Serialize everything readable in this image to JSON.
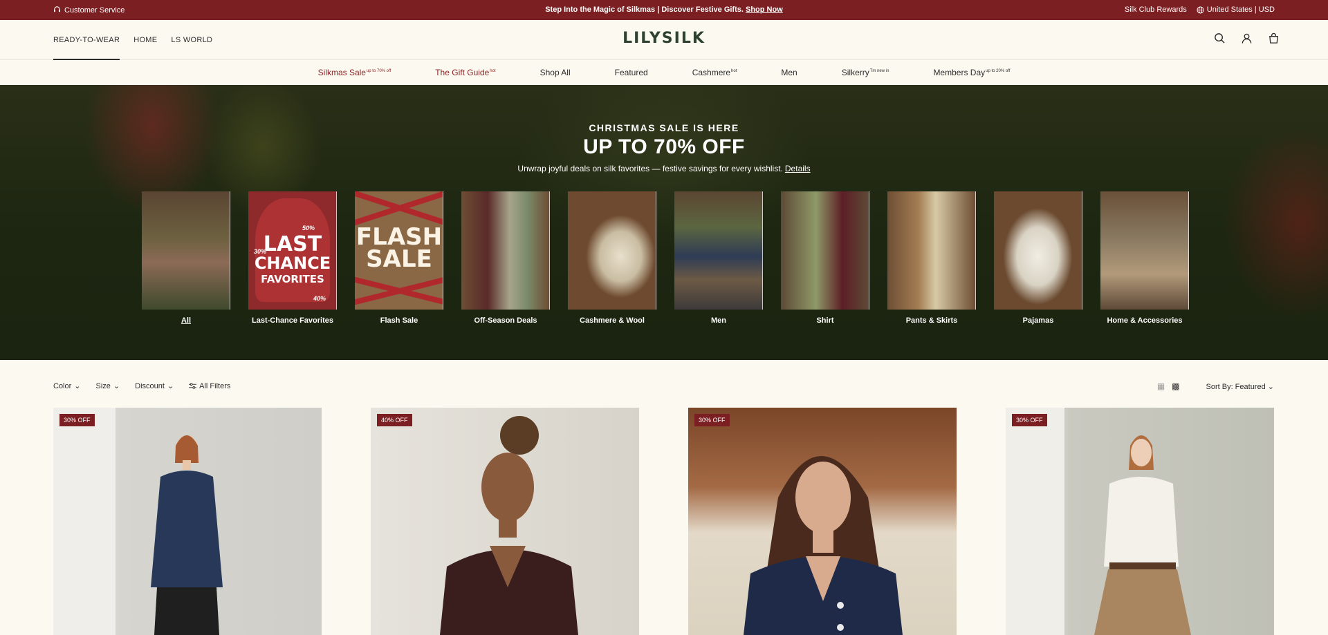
{
  "announcement": {
    "customer_service": "Customer Service",
    "promo": "Step Into the Magic of Silkmas | Discover Festive Gifts.",
    "promo_link": "Shop Now",
    "rewards": "Silk Club Rewards",
    "region": "United States | USD"
  },
  "header": {
    "nav": [
      "READY-TO-WEAR",
      "HOME",
      "LS WORLD"
    ],
    "logo": "LILYSILK",
    "icons": [
      "search-icon",
      "account-icon",
      "bag-icon"
    ]
  },
  "categories": [
    {
      "label": "Silkmas Sale",
      "sup": "up to 70% off",
      "highlight": true
    },
    {
      "label": "The Gift Guide",
      "sup": "hot",
      "highlight": true
    },
    {
      "label": "Shop All",
      "sup": "",
      "highlight": false
    },
    {
      "label": "Featured",
      "sup": "",
      "highlight": false
    },
    {
      "label": "Cashmere",
      "sup": "hot",
      "highlight": false
    },
    {
      "label": "Men",
      "sup": "",
      "highlight": false
    },
    {
      "label": "Silkerry",
      "sup": "Tm new in",
      "highlight": false
    },
    {
      "label": "Members Day",
      "sup": "up to 20% off",
      "highlight": false
    }
  ],
  "hero": {
    "subtitle": "CHRISTMAS SALE IS HERE",
    "title": "UP TO 70% OFF",
    "description": "Unwrap joyful deals on silk favorites — festive savings for every wishlist.",
    "details_link": "Details",
    "tiles": [
      "All",
      "Last-Chance Favorites",
      "Flash Sale",
      "Off-Season Deals",
      "Cashmere & Wool",
      "Men",
      "Shirt",
      "Pants & Skirts",
      "Pajamas",
      "Home & Accessories"
    ],
    "last_chance": {
      "line1": "LAST",
      "line2": "CHANCE",
      "line3": "FAVORITES",
      "pct_a": "50%",
      "pct_b": "30%",
      "pct_c": "40%"
    },
    "flash": {
      "line1": "FLASH",
      "line2": "SALE",
      "band_text": "SALE"
    }
  },
  "filters": {
    "items": [
      "Color",
      "Size",
      "Discount",
      "All Filters"
    ],
    "sort": "Sort By: Featured"
  },
  "products": [
    {
      "badge": "30% OFF"
    },
    {
      "badge": "40% OFF"
    },
    {
      "badge": "30% OFF"
    },
    {
      "badge": "30% OFF"
    }
  ],
  "colors": {
    "brand_red": "#7b1f22",
    "logo_green": "#2f4232",
    "background": "#fcfaf0"
  }
}
